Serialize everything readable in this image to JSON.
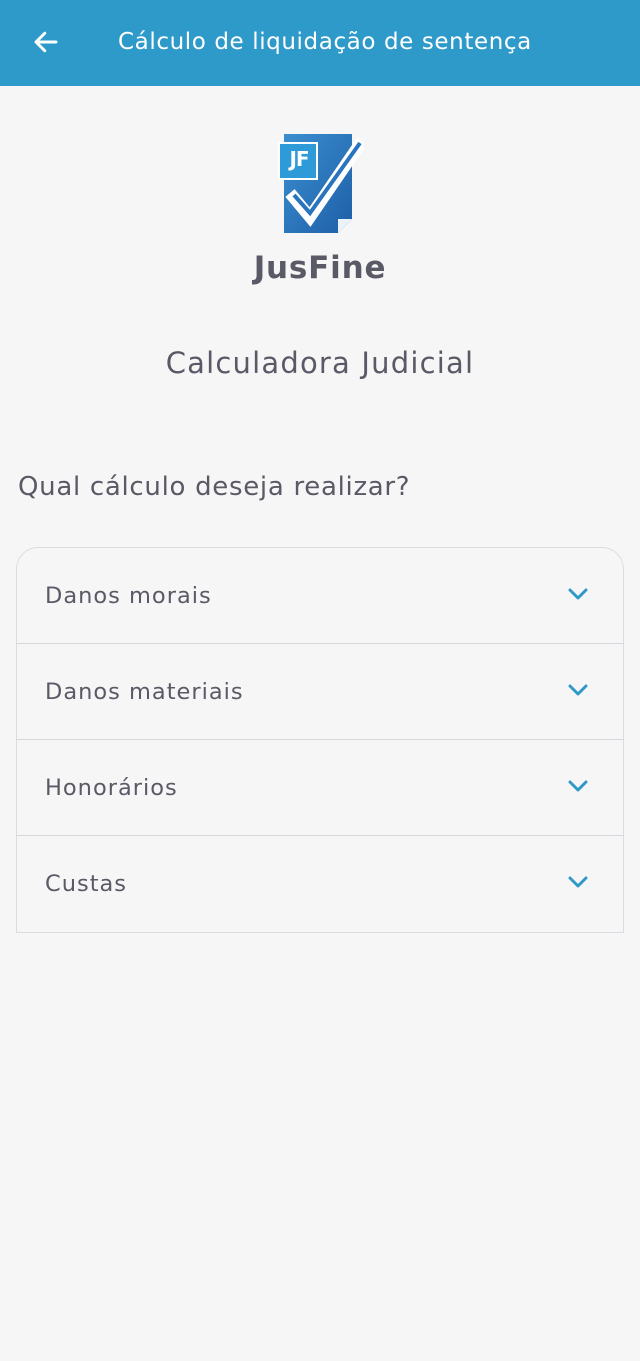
{
  "header": {
    "title": "Cálculo de liquidação de sentença",
    "back_icon": "arrow-left-icon",
    "background": "#2e9ac9"
  },
  "brand": {
    "logo_icon": "jusfine-logo-icon",
    "logo_text": "JF",
    "name": "JusFine",
    "subtitle": "Calculadora Judicial"
  },
  "main": {
    "question": "Qual cálculo deseja realizar?",
    "options": [
      {
        "label": "Danos morais",
        "icon": "chevron-down-icon"
      },
      {
        "label": "Danos materiais",
        "icon": "chevron-down-icon"
      },
      {
        "label": "Honorários",
        "icon": "chevron-down-icon"
      },
      {
        "label": "Custas",
        "icon": "chevron-down-icon"
      }
    ]
  },
  "colors": {
    "accent": "#2e9ac9",
    "text": "#5a5a66",
    "background": "#f6f6f7",
    "logo_blue": "#2a6fb8"
  }
}
